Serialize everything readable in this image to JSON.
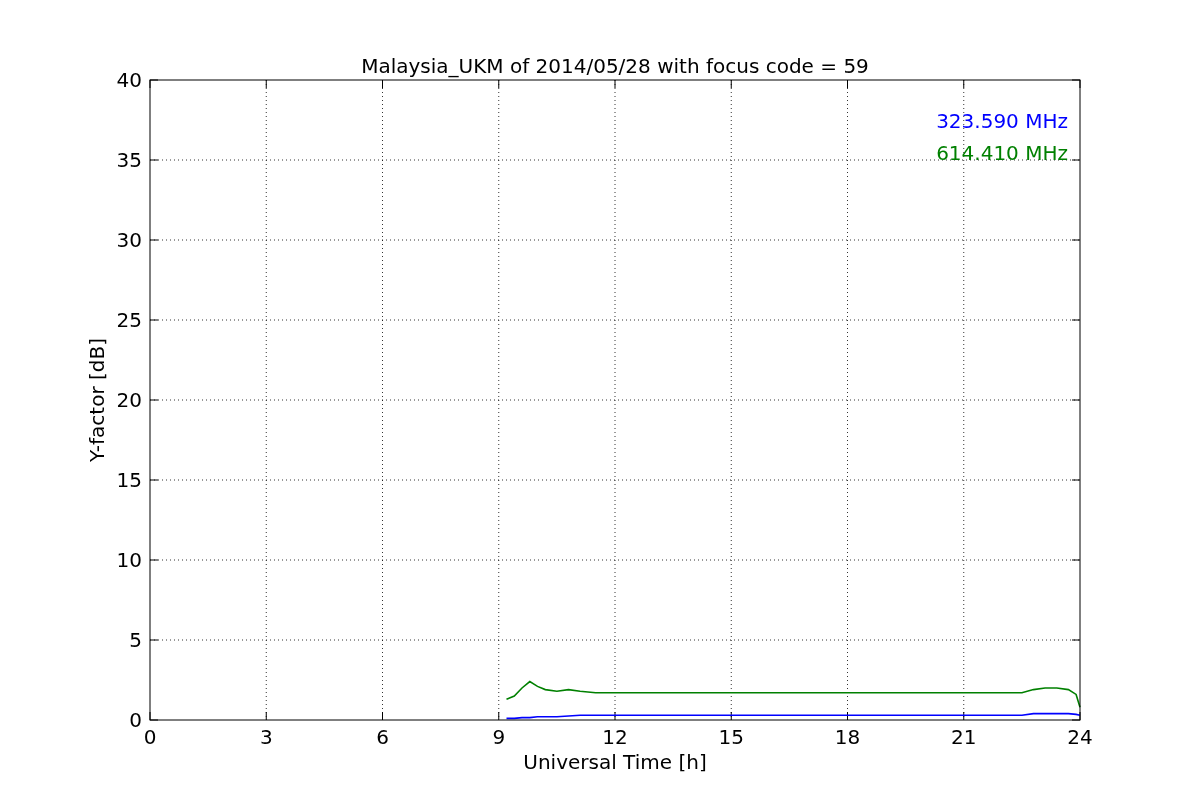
{
  "chart_data": {
    "type": "line",
    "title": "Malaysia_UKM of 2014/05/28 with focus code = 59",
    "xlabel": "Universal Time [h]",
    "ylabel": "Y-factor [dB]",
    "x": [
      9.2,
      9.4,
      9.6,
      9.8,
      10.0,
      10.2,
      10.5,
      10.8,
      11.1,
      11.5,
      22.5,
      22.8,
      23.1,
      23.4,
      23.7,
      23.9,
      24.0
    ],
    "series": [
      {
        "name": "323.590 MHz",
        "color": "#0000ff",
        "values": [
          0.1,
          0.1,
          0.15,
          0.15,
          0.2,
          0.2,
          0.2,
          0.25,
          0.3,
          0.3,
          0.3,
          0.4,
          0.4,
          0.4,
          0.4,
          0.35,
          0.3
        ]
      },
      {
        "name": "614.410 MHz",
        "color": "#008000",
        "values": [
          1.3,
          1.5,
          2.0,
          2.4,
          2.1,
          1.9,
          1.8,
          1.9,
          1.8,
          1.7,
          1.7,
          1.9,
          2.0,
          2.0,
          1.9,
          1.6,
          0.8
        ]
      }
    ],
    "xlim": [
      0,
      24
    ],
    "ylim": [
      0,
      40
    ],
    "xticks": [
      0,
      3,
      6,
      9,
      12,
      15,
      18,
      21,
      24
    ],
    "yticks": [
      0,
      5,
      10,
      15,
      20,
      25,
      30,
      35,
      40
    ],
    "grid": true
  }
}
